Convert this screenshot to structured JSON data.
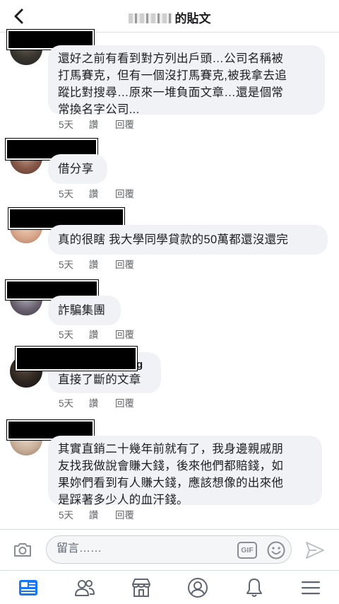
{
  "header": {
    "title_suffix": "的貼文",
    "back_icon": "chevron-left-icon"
  },
  "comments": [
    {
      "text": "還好之前有看到對方列出戶頭…公司名稱被\n打馬賽克，但有一個沒打馬賽克,被我拿去追\n蹤比對搜尋…原來一堆負面文章…還是個常\n常換名字公司...",
      "time": "5天",
      "like": "讚",
      "reply": "回覆"
    },
    {
      "text": "借分享",
      "time": "5天",
      "like": "讚",
      "reply": "回覆"
    },
    {
      "text": "真的很瞎 我大學同學貸款的50萬都還沒還完",
      "time": "5天",
      "like": "讚",
      "reply": "回覆"
    },
    {
      "text": "詐騙集團",
      "time": "5天",
      "like": "讚",
      "reply": "回覆"
    },
    {
      "name_suffix": "g",
      "text": "直接了斷的文章",
      "time": "5天",
      "like": "讚",
      "reply": "回覆"
    },
    {
      "text": "其實直銷二十幾年前就有了，我身邊親戚朋\n友找我做說會賺大錢，後來他們都賠錢，如\n果妳們看到有人賺大錢，應該想像的出來他\n是踩著多少人的血汗錢。",
      "time": "5天",
      "like": "讚",
      "reply": "回覆"
    }
  ],
  "composer": {
    "placeholder": "留言……",
    "gif_label": "GIF",
    "icons": [
      "camera-icon",
      "gif-icon",
      "emoji-icon",
      "send-icon"
    ]
  },
  "tabbar": {
    "icons": [
      "news-feed-icon",
      "friends-icon",
      "marketplace-icon",
      "profile-icon",
      "notifications-icon",
      "menu-icon"
    ],
    "accent": "#1877f2",
    "inactive": "#606770"
  }
}
